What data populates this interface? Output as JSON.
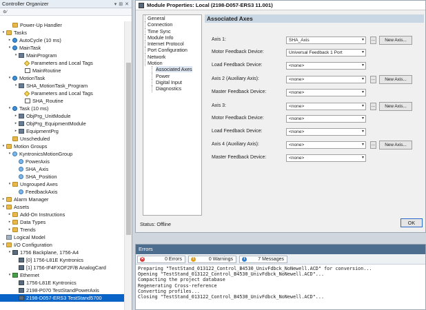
{
  "organizer": {
    "title": "Controller Organizer",
    "title_buttons": [
      "▾",
      "⊞",
      "✕"
    ],
    "toolbar": "⚙⁄",
    "tree": [
      {
        "label": "Power-Up Handler",
        "depth": 1,
        "icon": "folder",
        "expander": ""
      },
      {
        "label": "Tasks",
        "depth": 0,
        "icon": "folder",
        "expander": "▾"
      },
      {
        "label": "AutoCycle (10 ms)",
        "depth": 1,
        "icon": "task",
        "expander": "▸"
      },
      {
        "label": "MainTask",
        "depth": 1,
        "icon": "task",
        "expander": "▾"
      },
      {
        "label": "MainProgram",
        "depth": 2,
        "icon": "program",
        "expander": "▾"
      },
      {
        "label": "Parameters and Local Tags",
        "depth": 3,
        "icon": "tags",
        "expander": ""
      },
      {
        "label": "MainRoutine",
        "depth": 3,
        "icon": "routine",
        "expander": ""
      },
      {
        "label": "MotionTask",
        "depth": 1,
        "icon": "task",
        "expander": "▾"
      },
      {
        "label": "SHA_MotionTask_Program",
        "depth": 2,
        "icon": "program",
        "expander": "▾"
      },
      {
        "label": "Parameters and Local Tags",
        "depth": 3,
        "icon": "tags",
        "expander": ""
      },
      {
        "label": "SHA_Routine",
        "depth": 3,
        "icon": "routine",
        "expander": ""
      },
      {
        "label": "Task (10 ms)",
        "depth": 1,
        "icon": "task",
        "expander": "▾"
      },
      {
        "label": "ObjPrg_UnitModule",
        "depth": 2,
        "icon": "program",
        "expander": "▸"
      },
      {
        "label": "ObjPrg_EquipmentModule",
        "depth": 2,
        "icon": "program",
        "expander": "▸"
      },
      {
        "label": "EquipmentPrg",
        "depth": 2,
        "icon": "program",
        "expander": "▸"
      },
      {
        "label": "Unscheduled",
        "depth": 1,
        "icon": "folder",
        "expander": ""
      },
      {
        "label": "Motion Groups",
        "depth": 0,
        "icon": "folder",
        "expander": "▾"
      },
      {
        "label": "KyntronicsMotionGroup",
        "depth": 1,
        "icon": "axis",
        "expander": "▾"
      },
      {
        "label": "PowerAxis",
        "depth": 2,
        "icon": "axis",
        "expander": ""
      },
      {
        "label": "SHA_Axis",
        "depth": 2,
        "icon": "axis",
        "expander": ""
      },
      {
        "label": "SHA_Position",
        "depth": 2,
        "icon": "axis",
        "expander": ""
      },
      {
        "label": "Ungrouped Axes",
        "depth": 1,
        "icon": "folder",
        "expander": "▾"
      },
      {
        "label": "FeedbackAxis",
        "depth": 2,
        "icon": "axis",
        "expander": ""
      },
      {
        "label": "Alarm Manager",
        "depth": 0,
        "icon": "folder",
        "expander": "▸"
      },
      {
        "label": "Assets",
        "depth": 0,
        "icon": "folder",
        "expander": "▾"
      },
      {
        "label": "Add-On Instructions",
        "depth": 1,
        "icon": "folder",
        "expander": "▸"
      },
      {
        "label": "Data Types",
        "depth": 1,
        "icon": "folder",
        "expander": "▸"
      },
      {
        "label": "Trends",
        "depth": 1,
        "icon": "folder",
        "expander": "▸"
      },
      {
        "label": "Logical Model",
        "depth": 0,
        "icon": "model",
        "expander": ""
      },
      {
        "label": "I/O Configuration",
        "depth": 0,
        "icon": "folder",
        "expander": "▾"
      },
      {
        "label": "1756 Backplane, 1756-A4",
        "depth": 1,
        "icon": "module",
        "expander": "▾"
      },
      {
        "label": "[0] 1756-L81E Kyntronics",
        "depth": 2,
        "icon": "module",
        "expander": ""
      },
      {
        "label": "[1] 1756-IF4FXOF2F/B AnalogCard",
        "depth": 2,
        "icon": "module",
        "expander": ""
      },
      {
        "label": "Ethernet",
        "depth": 1,
        "icon": "ethernet",
        "expander": "▾"
      },
      {
        "label": "1756-L81E Kyntronics",
        "depth": 2,
        "icon": "module",
        "expander": ""
      },
      {
        "label": "2198-P070 TestStandPowerAxis",
        "depth": 2,
        "icon": "module",
        "expander": ""
      },
      {
        "label": "2198-D057-ERS3 TestStand5700",
        "depth": 2,
        "icon": "module",
        "expander": "",
        "selected": true
      }
    ]
  },
  "module_window": {
    "title": "Module Properties: Local (2198-D057-ERS3 11.001)",
    "nav": [
      {
        "label": "General",
        "child": false
      },
      {
        "label": "Connection",
        "child": false
      },
      {
        "label": "Time Sync",
        "child": false
      },
      {
        "label": "Module Info",
        "child": false
      },
      {
        "label": "Internet Protocol",
        "child": false
      },
      {
        "label": "Port Configuration",
        "child": false
      },
      {
        "label": "Network",
        "child": false
      },
      {
        "label": "Motion",
        "child": false
      },
      {
        "label": "Associated Axes",
        "child": true,
        "active": true
      },
      {
        "label": "Power",
        "child": true
      },
      {
        "label": "Digital Input",
        "child": true
      },
      {
        "label": "Diagnostics",
        "child": true
      }
    ],
    "section_title": "Associated Axes",
    "fields": [
      {
        "label": "Axis 1:",
        "value": "SHA_Axis",
        "buttons": true
      },
      {
        "label": "Motor Feedback Device:",
        "value": "Universal Feedback 1 Port",
        "buttons": false
      },
      {
        "label": "Load Feedback Device:",
        "value": "<none>",
        "buttons": false
      },
      {
        "label": "Axis 2  (Auxiliary Axis):",
        "value": "<none>",
        "buttons": true
      },
      {
        "label": "Master Feedback Device:",
        "value": "<none>",
        "buttons": false
      },
      {
        "label": "Axis 3:",
        "value": "<none>",
        "buttons": true
      },
      {
        "label": "Motor Feedback Device:",
        "value": "<none>",
        "buttons": false
      },
      {
        "label": "Load Feedback Device:",
        "value": "<none>",
        "buttons": false
      },
      {
        "label": "Axis 4  (Auxiliary Axis):",
        "value": "<none>",
        "buttons": true
      },
      {
        "label": "Master Feedback Device:",
        "value": "<none>",
        "buttons": false
      }
    ],
    "dots_label": "...",
    "new_axis_label": "New Axis...",
    "status_label": "Status:",
    "status_value": "Offline",
    "ok_label": "OK"
  },
  "errors": {
    "title": "Errors",
    "filters": [
      {
        "label": "0 Errors",
        "icon": "error-icon",
        "color": "#d83b3b",
        "glyph": "✕"
      },
      {
        "label": "0 Warnings",
        "icon": "warning-icon",
        "color": "#e3a21a",
        "glyph": "!"
      },
      {
        "label": "7 Messages",
        "icon": "info-icon",
        "color": "#2f7fd1",
        "glyph": "i"
      }
    ],
    "log": [
      "Preparing \"TestStand_013122_Control_B4530_UnivFdbck_NoNewell.ACD\" for conversion...",
      "Opening \"TestStand_013122_Control_B4530_UnivFdbck_NoNewell.ACD\"...",
      "Compacting the project database",
      "Regenerating Cross-reference",
      "Converting profiles...",
      "Closing \"TestStand_013122_Control_B4530_UnivFdbck_NoNewell.ACD\"..."
    ]
  }
}
